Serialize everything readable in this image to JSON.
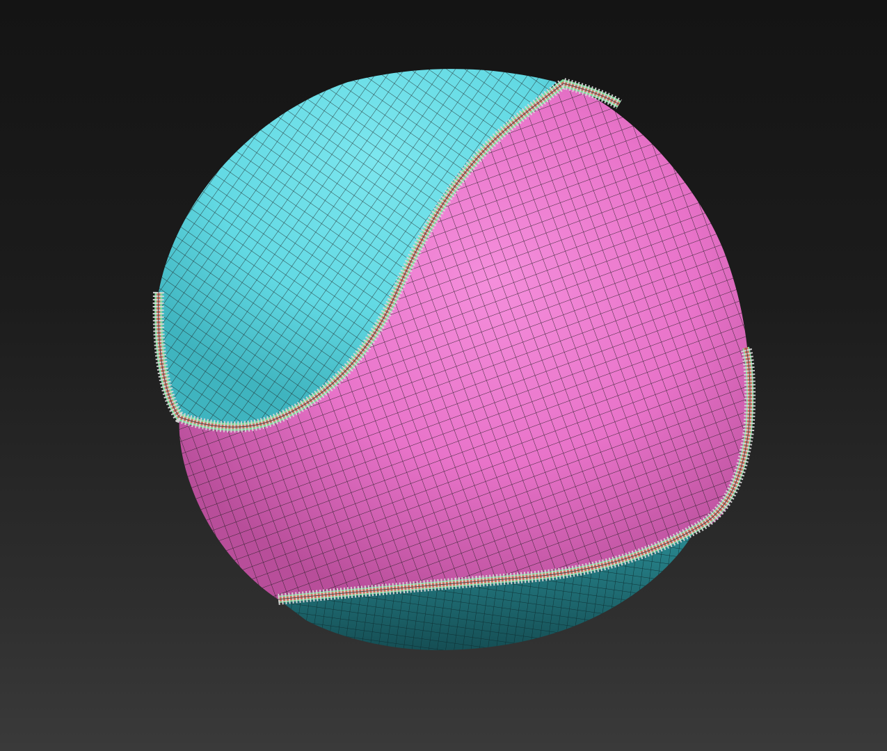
{
  "viewport": {
    "background_top": "#141414",
    "background_bottom": "#3a3a3a"
  },
  "model": {
    "object": "baseball-sphere",
    "display_mode": "polyframe-wireframe",
    "polygroup_colors": {
      "upper_panel": "#62d9e3",
      "main_panel": "#e873c9",
      "lower_panel": "#1f6c73",
      "seam_stitches": "#d8d8d8",
      "seam_thread": "#d46a5a",
      "seam_inner": "#7fd89a",
      "wire": "#1c1c1c"
    }
  }
}
